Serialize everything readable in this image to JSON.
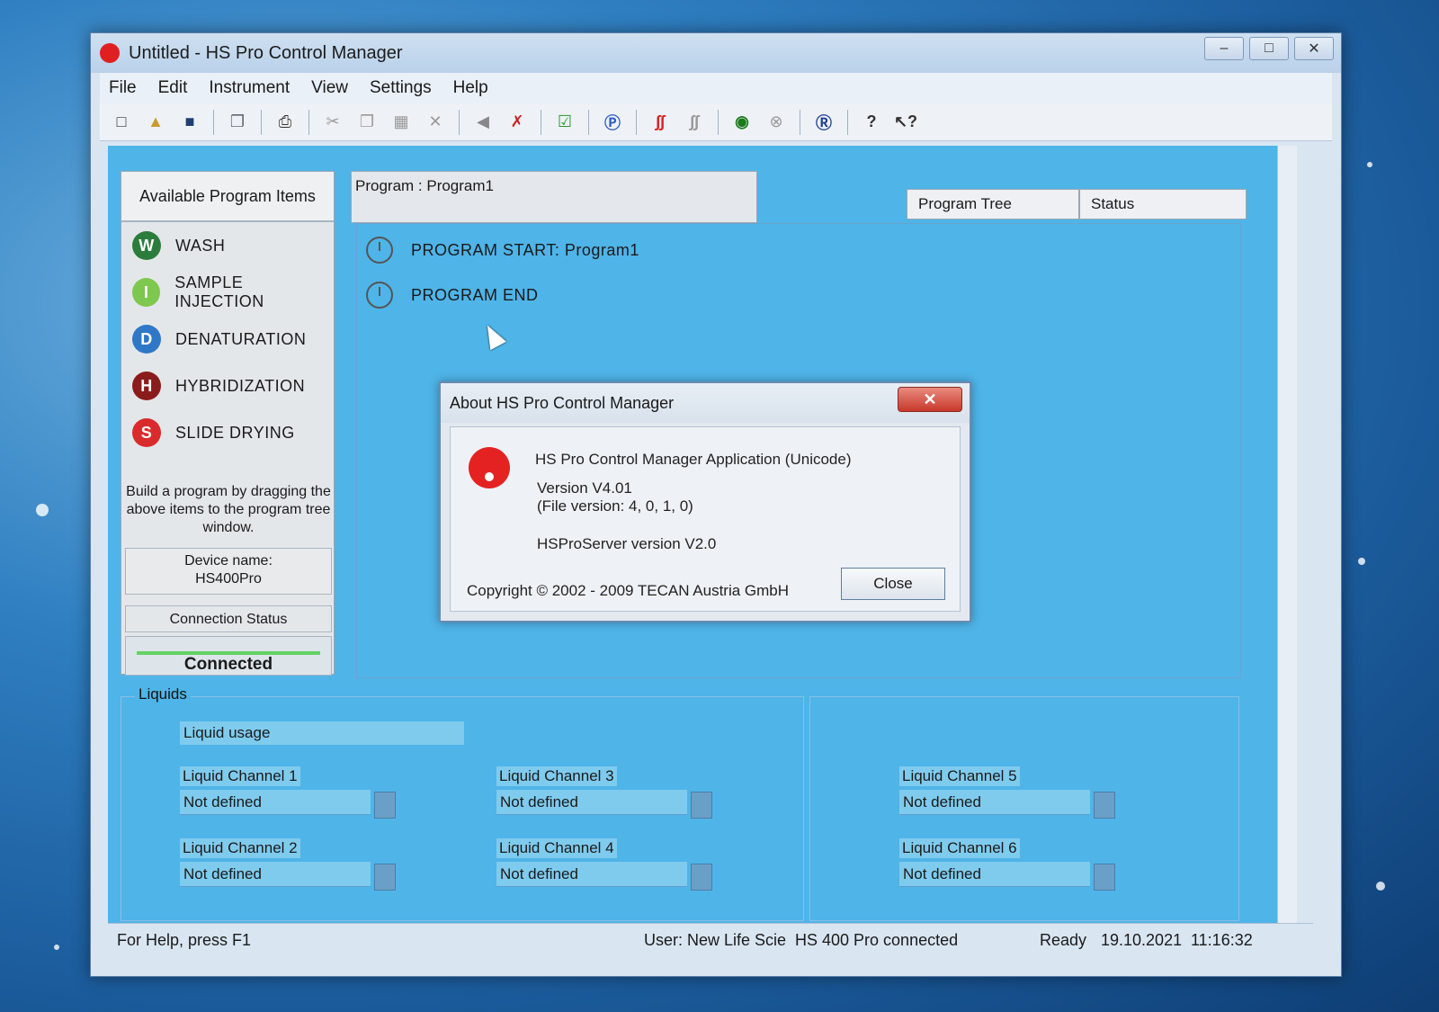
{
  "window": {
    "title": "Untitled - HS Pro Control Manager",
    "buttons": {
      "min": "–",
      "max": "□",
      "close": "✕"
    }
  },
  "menu": [
    "File",
    "Edit",
    "Instrument",
    "View",
    "Settings",
    "Help"
  ],
  "toolbar": [
    "new-icon",
    "open-icon",
    "save-icon",
    "copy-window-icon",
    "print-icon",
    "cut-icon",
    "copy-icon",
    "paste-icon",
    "delete-icon",
    "back-icon",
    "disconnect-icon",
    "check-icon",
    "p-icon",
    "heat-icon",
    "heat-off-icon",
    "go-icon",
    "stop-icon",
    "r-icon",
    "help-icon",
    "context-help-icon"
  ],
  "left": {
    "heading": "Available Program Items",
    "items": [
      {
        "letter": "W",
        "label": "WASH",
        "color": "#2c7d3c"
      },
      {
        "letter": "I",
        "label": "SAMPLE INJECTION",
        "color": "#7ec84f"
      },
      {
        "letter": "D",
        "label": "DENATURATION",
        "color": "#2f78c8"
      },
      {
        "letter": "H",
        "label": "HYBRIDIZATION",
        "color": "#8b1c1c"
      },
      {
        "letter": "S",
        "label": "SLIDE DRYING",
        "color": "#d92b2b"
      }
    ],
    "hint": "Build a program by dragging the above items to the program tree window.",
    "device_label": "Device name:",
    "device_name": "HS400Pro",
    "connection_heading": "Connection Status",
    "connection_status": "Connected"
  },
  "program": {
    "header": "Program  : Program1",
    "nodes": [
      "PROGRAM START: Program1",
      "PROGRAM END"
    ]
  },
  "tabs": [
    "Program Tree",
    "Status"
  ],
  "liquids": {
    "legend": "Liquids",
    "usage": "Liquid usage",
    "channels": [
      {
        "label": "Liquid Channel 1",
        "value": "Not defined"
      },
      {
        "label": "Liquid Channel 2",
        "value": "Not defined"
      },
      {
        "label": "Liquid Channel 3",
        "value": "Not defined"
      },
      {
        "label": "Liquid Channel 4",
        "value": "Not defined"
      },
      {
        "label": "Liquid Channel 5",
        "value": "Not defined"
      },
      {
        "label": "Liquid Channel 6",
        "value": "Not defined"
      }
    ]
  },
  "status": {
    "help": "For Help, press F1",
    "user": "User: New Life Scie",
    "device": "HS 400 Pro connected",
    "state": "Ready",
    "date": "19.10.2021",
    "time": "11:16:32"
  },
  "dialog": {
    "title": "About HS Pro Control Manager",
    "close_icon": "✕",
    "app": "HS Pro Control Manager Application (Unicode)",
    "version": "Version V4.01",
    "file_version": "(File version: 4, 0, 1, 0)",
    "server": "HSProServer version V2.0",
    "copyright": "Copyright © 2002 - 2009 TECAN Austria GmbH",
    "button": "Close"
  }
}
